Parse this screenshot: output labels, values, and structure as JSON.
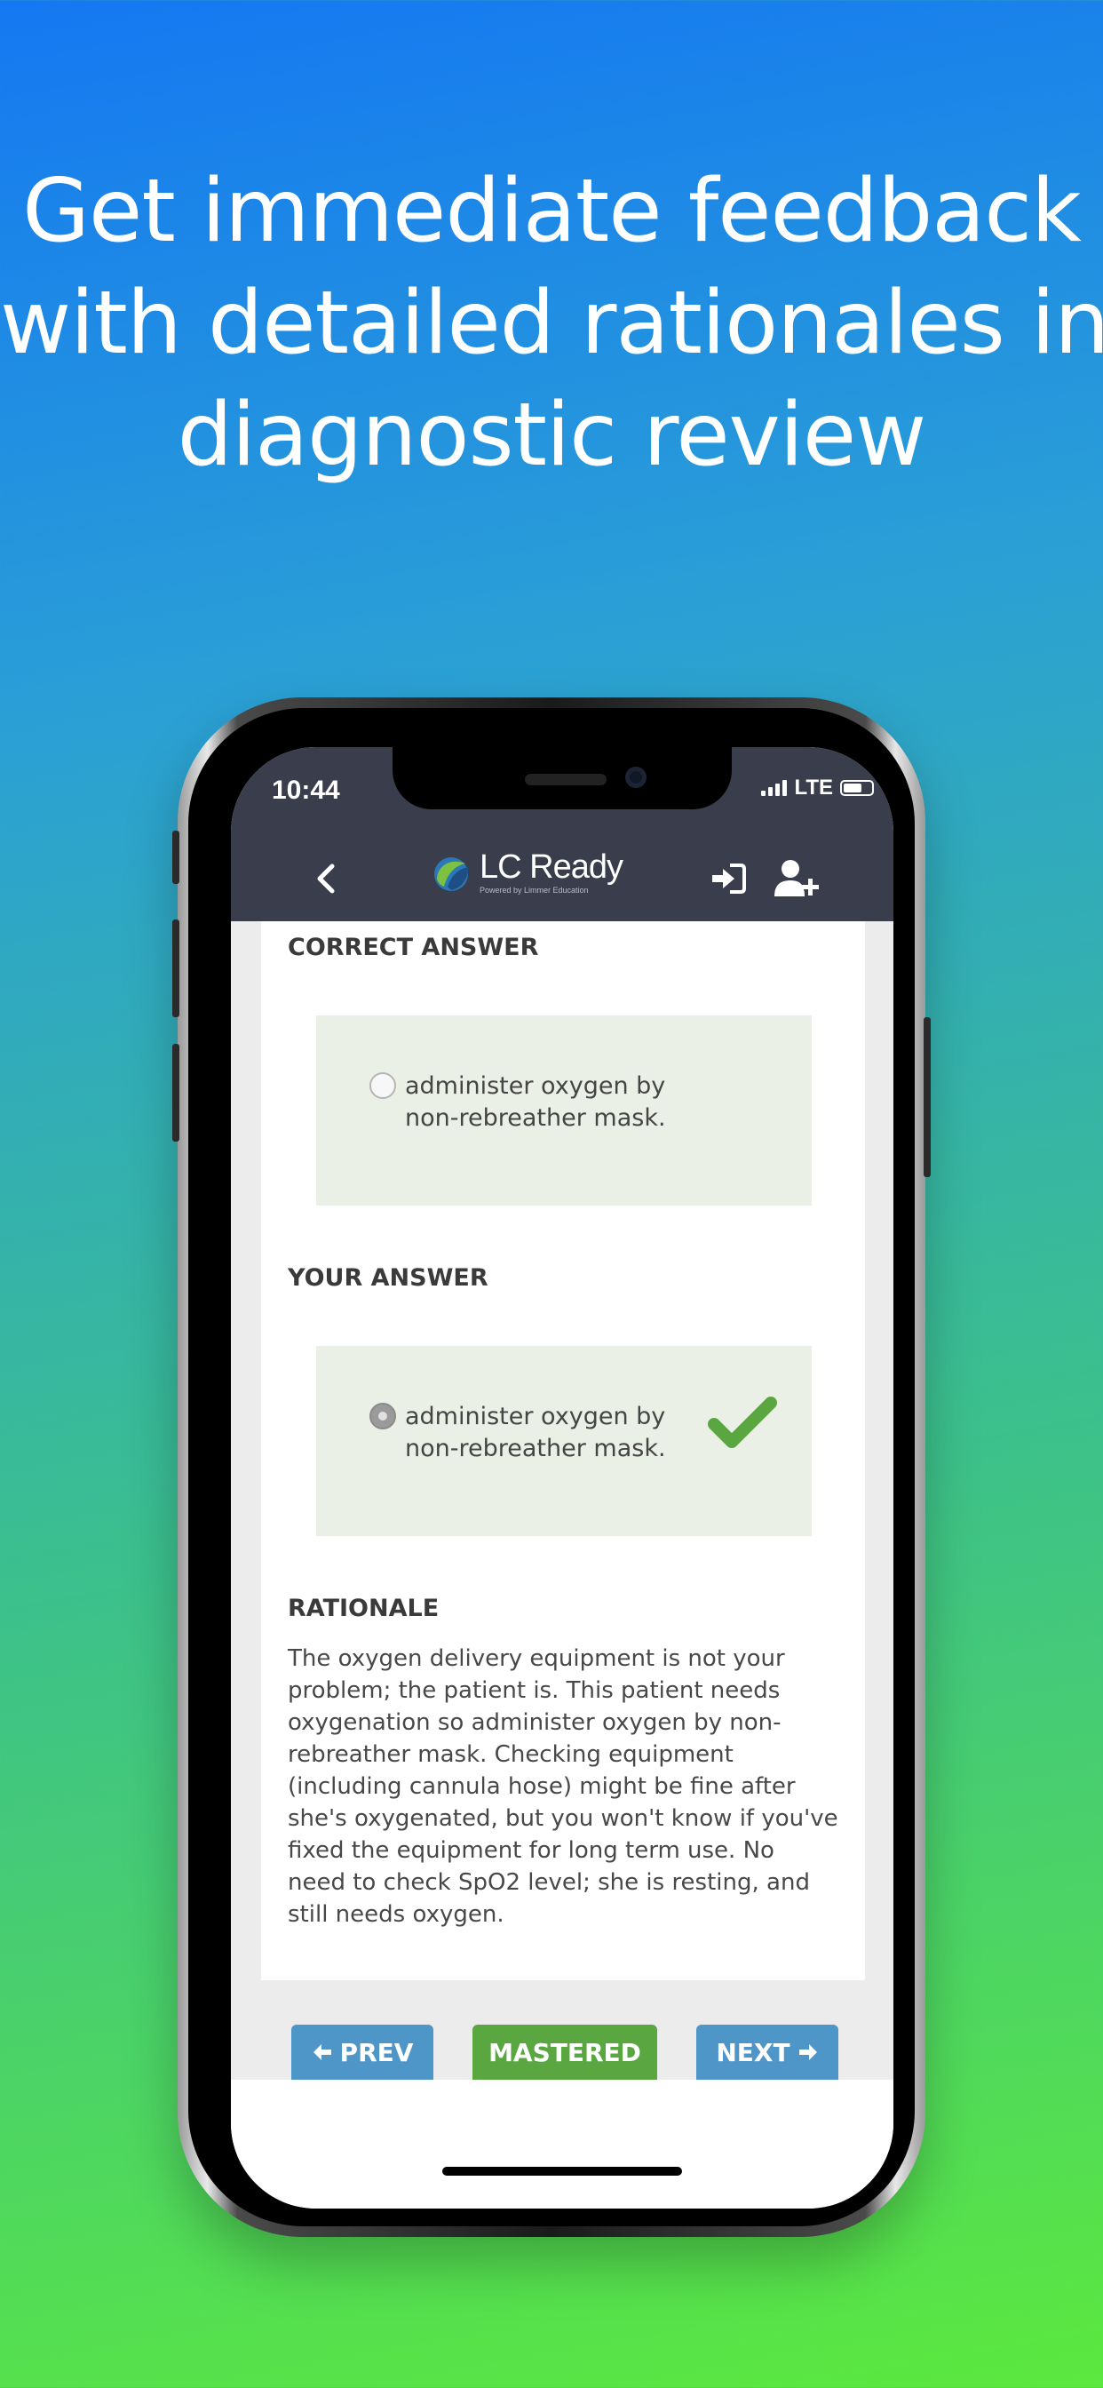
{
  "headline": {
    "line1": "Get immediate feedback",
    "line2": "with detailed rationales in",
    "line3": "diagnostic review"
  },
  "status_bar": {
    "time": "10:44",
    "network": "LTE"
  },
  "navbar": {
    "logo_title": "LC Ready",
    "logo_subtitle": "Powered by Limmer Education",
    "icons": [
      "back-icon",
      "login-icon",
      "add-user-icon"
    ]
  },
  "question_review": {
    "correct_answer_label": "CORRECT ANSWER",
    "correct_answer_text": "administer oxygen by non-rebreather mask.",
    "your_answer_label": "YOUR ANSWER",
    "your_answer_text": "administer oxygen by non-rebreather mask.",
    "rationale_label": "RATIONALE",
    "rationale_text": "The oxygen delivery equipment is not your problem; the patient is. This patient needs oxygenation so administer oxygen by non-rebreather mask. Checking equipment (including cannula hose) might be fine after she's oxygenated, but you won't know if you've fixed the equipment for long term use. No need to check SpO2 level; she is resting, and still needs oxygen."
  },
  "buttons": {
    "prev": "PREV",
    "mastered": "MASTERED",
    "next": "NEXT"
  },
  "colors": {
    "navbar": "#3a3d4c",
    "answer_box": "#ebf0e6",
    "check": "#5aa640",
    "nav_button": "#4e96c8",
    "mastered_button": "#5aa640"
  }
}
